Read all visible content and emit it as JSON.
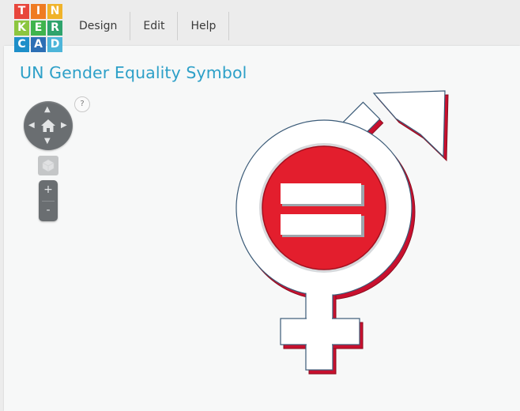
{
  "logo": {
    "letters": [
      "T",
      "I",
      "N",
      "K",
      "E",
      "R",
      "C",
      "A",
      "D"
    ],
    "colors": [
      "#e8463c",
      "#ef7b22",
      "#f0b32a",
      "#8cc63f",
      "#3fb44d",
      "#2ea36c",
      "#1e8fc9",
      "#2c6fb5",
      "#4db5d9"
    ]
  },
  "menu": {
    "design": "Design",
    "edit": "Edit",
    "help": "Help"
  },
  "workspace": {
    "title": "UN Gender Equality Symbol",
    "help_label": "?"
  },
  "navigation": {
    "up_icon": "chevron-up-icon",
    "down_icon": "chevron-down-icon",
    "left_icon": "chevron-left-icon",
    "right_icon": "chevron-right-icon",
    "home_icon": "home-icon",
    "view_cube_icon": "cube-icon"
  },
  "zoom": {
    "in_label": "+",
    "out_label": "-"
  },
  "colors": {
    "accent": "#2da0c8",
    "symbol_red": "#e31e2d",
    "symbol_white": "#ffffff"
  }
}
